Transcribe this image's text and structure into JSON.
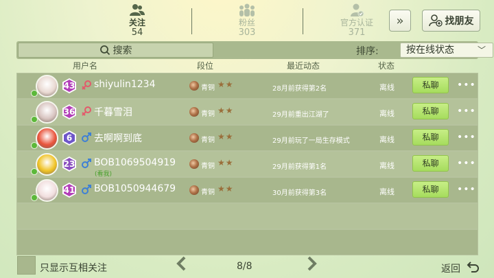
{
  "tabs": [
    {
      "label": "关注",
      "count": "54",
      "icon": "people-icon"
    },
    {
      "label": "粉丝",
      "count": "303",
      "icon": "group-icon"
    },
    {
      "label": "官方认证",
      "count": "371",
      "icon": "verified-user-icon"
    }
  ],
  "find_friend_label": "找朋友",
  "search": {
    "label": "搜索"
  },
  "sort": {
    "label": "排序:",
    "value": "按在线状态"
  },
  "columns": {
    "user": "用户名",
    "rank": "段位",
    "activity": "最近动态",
    "status": "状态"
  },
  "rows": [
    {
      "level": "43",
      "gender": "female",
      "name": "shiyulin1234",
      "rank": "青铜",
      "activity": "28月前获得第2名",
      "status": "离线",
      "chat": "私聊",
      "avatar_color": "#e9d9d2",
      "level_color": "#b23fb8"
    },
    {
      "level": "36",
      "gender": "female",
      "name": "千暮雪泪",
      "rank": "青铜",
      "activity": "29月前重出江湖了",
      "status": "离线",
      "chat": "私聊",
      "avatar_color": "#d8c4c0",
      "level_color": "#b23fb8"
    },
    {
      "level": "6",
      "gender": "male",
      "name": "去啊啊到底",
      "rank": "青铜",
      "activity": "29月前玩了一局生存模式",
      "status": "离线",
      "chat": "私聊",
      "avatar_color": "#e9533b",
      "level_color": "#6f57c9"
    },
    {
      "level": "23",
      "gender": "male",
      "name": "BOB1069504919",
      "sub": "(看我)",
      "rank": "青铜",
      "activity": "29月前获得第1名",
      "status": "离线",
      "chat": "私聊",
      "avatar_color": "#f0c326",
      "level_color": "#8a4fbf"
    },
    {
      "level": "41",
      "gender": "male",
      "name": "BOB1050944679",
      "rank": "青铜",
      "activity": "30月前获得第3名",
      "status": "离线",
      "chat": "私聊",
      "avatar_color": "#f1dede",
      "level_color": "#b23fb8"
    }
  ],
  "footer": {
    "mutual_label": "只显示互相关注",
    "page": "8/8",
    "back_label": "返回"
  }
}
